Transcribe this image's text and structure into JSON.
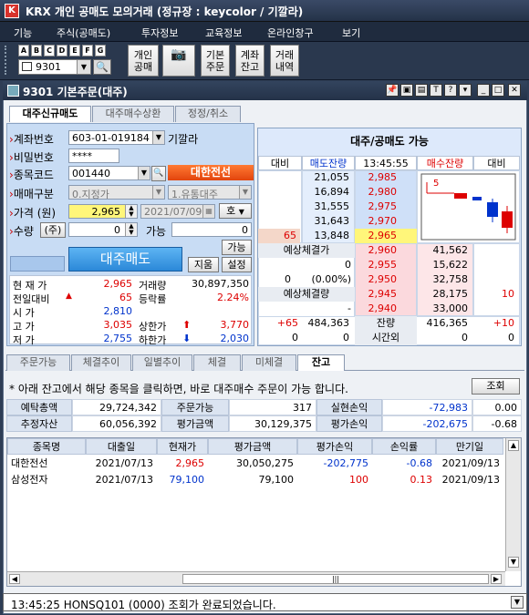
{
  "app": {
    "title": "KRX 개인 공매도 모의거래 (정규장 : keycolor / 기깔라)",
    "logo": "K"
  },
  "menu": [
    "기능",
    "주식(공매도)",
    "투자정보",
    "교육정보",
    "온라인창구",
    "보기"
  ],
  "toolbar": {
    "letters": [
      "A",
      "B",
      "C",
      "D",
      "E",
      "F",
      "G"
    ],
    "screen_code": "9301",
    "buttons": [
      {
        "l1": "개인",
        "l2": "공매"
      },
      {
        "l1": "",
        "l2": ""
      },
      {
        "l1": "기본",
        "l2": "주문"
      },
      {
        "l1": "계좌",
        "l2": "잔고"
      },
      {
        "l1": "거래",
        "l2": "내역"
      }
    ]
  },
  "window": {
    "title": "9301 기본주문(대주)",
    "buttons": [
      "📌",
      "▣",
      "▤",
      "T",
      "?",
      "▾",
      "_",
      "□",
      "✕"
    ]
  },
  "tabs": [
    "대주신규매도",
    "대주매수상환",
    "정정/취소"
  ],
  "form": {
    "account_label": "계좌번호",
    "account": "603-01-019184",
    "owner": "기깔라",
    "password_label": "비밀번호",
    "password": "****",
    "code_label": "종목코드",
    "code": "001440",
    "stock_name": "대한전선",
    "type_label": "매매구분",
    "type": "0.지정가",
    "type2": "1.유통대주",
    "price_label": "가격 (원)",
    "price": "2,965",
    "date": "2021/07/09",
    "hoga_btn": "호",
    "qty_label": "수량",
    "qty_btn": "(주)",
    "qty": "0",
    "avail_label": "가능",
    "avail": "0",
    "avail_btn": "가능",
    "sell_btn": "대주매도",
    "inquiry_btn": "지움",
    "setting_btn": "설정"
  },
  "stats": {
    "rows": [
      {
        "l": "현 재 가",
        "v": "2,965",
        "l2": "거래량",
        "v2": "30,897,350"
      },
      {
        "l": "전일대비",
        "arrow": "▲",
        "v": "65",
        "l2": "등락률",
        "v2": "2.24%"
      },
      {
        "l": "시    가",
        "v": "2,810",
        "l2": "",
        "v2": ""
      },
      {
        "l": "고    가",
        "v": "3,035",
        "l2": "상한가",
        "arrow2": "⬆",
        "v2": "3,770"
      },
      {
        "l": "저    가",
        "v": "2,755",
        "l2": "하한가",
        "arrow2": "⬇",
        "v2": "2,030"
      }
    ]
  },
  "hoga": {
    "title": "대주/공매도 가능",
    "headers": [
      "대비",
      "매도잔량",
      "13:45:55",
      "매수잔량",
      "대비"
    ],
    "asks": [
      {
        "vol": "21,055",
        "price": "2,985"
      },
      {
        "vol": "16,894",
        "price": "2,980"
      },
      {
        "vol": "31,555",
        "price": "2,975"
      },
      {
        "vol": "31,643",
        "price": "2,970"
      },
      {
        "chg": "65",
        "vol": "13,848",
        "price": "2,965"
      }
    ],
    "exp_price_label": "예상체결가",
    "exp_vol_label": "예상체결량",
    "mid_rows": [
      {
        "a": "0",
        "b": ""
      },
      {
        "a": "0",
        "b": "(0.00%)"
      }
    ],
    "bids": [
      {
        "price": "2,960",
        "vol": "41,562",
        "chg": ""
      },
      {
        "price": "2,955",
        "vol": "15,622",
        "chg": ""
      },
      {
        "price": "2,950",
        "vol": "32,758",
        "chg": ""
      },
      {
        "price": "2,945",
        "vol": "28,175",
        "chg": "10"
      },
      {
        "price": "2,940",
        "vol": "33,000",
        "chg": ""
      }
    ],
    "minus": "-",
    "tot_chg_ask": "+65",
    "tot_ask": "484,363",
    "tot_label": "잔량",
    "tot_bid": "416,365",
    "tot_chg_bid": "+10",
    "after_ask_chg": "0",
    "after_ask": "0",
    "after_label": "시간외",
    "after_bid": "0",
    "after_bid_chg": "0",
    "chart_marker": "5"
  },
  "bottom_tabs": [
    "주문가능",
    "체결추이",
    "일별추이",
    "체결",
    "미체결",
    "잔고"
  ],
  "notice": "* 아래 잔고에서 해당 종목을 클릭하면, 바로 대주매수 주문이 가능 합니다.",
  "inquiry_button": "조회",
  "summary": [
    {
      "l1": "예탁총액",
      "v1": "29,724,342",
      "l2": "주문가능",
      "v2": "317",
      "l3": "실현손익",
      "v3": "-72,983",
      "v4": "0.00"
    },
    {
      "l1": "추정자산",
      "v1": "60,056,392",
      "l2": "평가금액",
      "v2": "30,129,375",
      "l3": "평가손익",
      "v3": "-202,675",
      "v4": "-0.68"
    }
  ],
  "holdings": {
    "headers": [
      "종목명",
      "대출일",
      "현재가",
      "평가금액",
      "평가손익",
      "손익률",
      "만기일"
    ],
    "rows": [
      [
        "대한전선",
        "2021/07/13",
        "2,965",
        "30,050,275",
        "-202,775",
        "-0.68",
        "2021/09/13"
      ],
      [
        "삼성전자",
        "2021/07/13",
        "79,100",
        "79,100",
        "100",
        "0.13",
        "2021/09/13"
      ]
    ]
  },
  "status": "13:45:25 HONSQ101 (0000) 조회가 완료되었습니다."
}
